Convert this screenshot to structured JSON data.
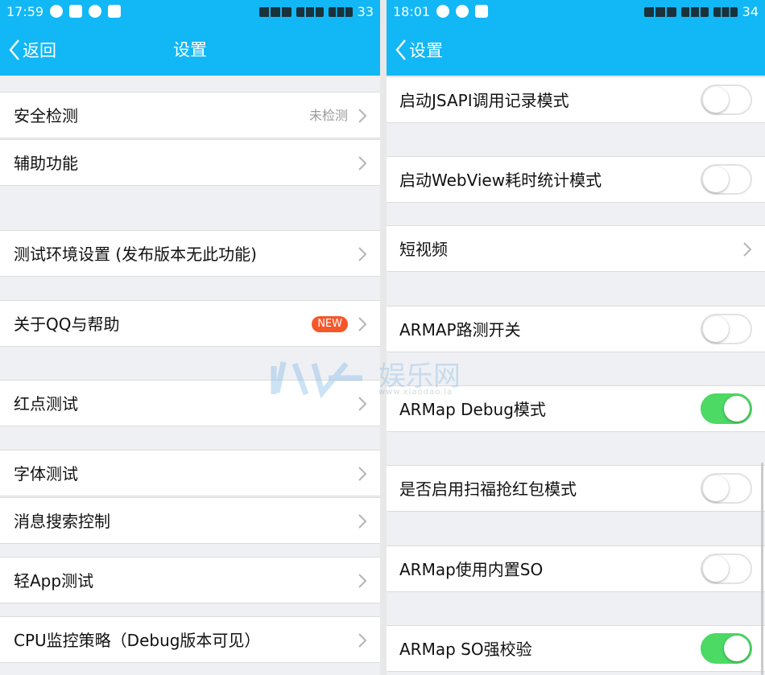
{
  "left": {
    "status": {
      "time": "17:59",
      "battery": "33"
    },
    "header": {
      "back_label": "返回",
      "title": "设置"
    },
    "items": [
      {
        "label": "安全检测",
        "value": "未检测"
      },
      {
        "label": "辅助功能"
      },
      {
        "label": "测试环境设置 (发布版本无此功能)"
      },
      {
        "label": "关于QQ与帮助",
        "badge": "NEW"
      },
      {
        "label": "红点测试"
      },
      {
        "label": "字体测试"
      },
      {
        "label": "消息搜索控制"
      },
      {
        "label": "轻App测试"
      },
      {
        "label": "CPU监控策略（Debug版本可见）"
      }
    ]
  },
  "right": {
    "status": {
      "time": "18:01",
      "battery": "34"
    },
    "header": {
      "back_label": "设置"
    },
    "items": [
      {
        "label": "启动JSAPI调用记录模式",
        "toggle": false
      },
      {
        "label": "启动WebView耗时统计模式",
        "toggle": false
      },
      {
        "label": "短视频"
      },
      {
        "label": "ARMAP路测开关",
        "toggle": false
      },
      {
        "label": "ARMap Debug模式",
        "toggle": true
      },
      {
        "label": "是否启用扫福抢红包模式",
        "toggle": false
      },
      {
        "label": "ARMap使用内置SO",
        "toggle": false
      },
      {
        "label": "ARMap SO强校验",
        "toggle": true
      }
    ]
  },
  "watermark": {
    "text": "娱乐网",
    "url": "www.xiaodao.la"
  },
  "colors": {
    "accent": "#12b7f5",
    "toggle_on": "#4cd964",
    "badge": "#f5572a"
  }
}
